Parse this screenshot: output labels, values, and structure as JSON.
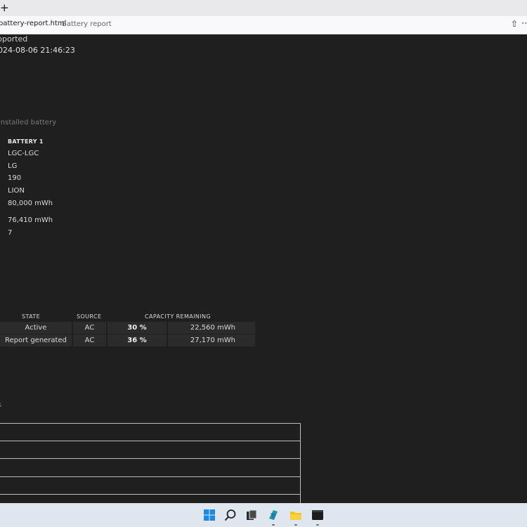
{
  "browser": {
    "new_tab_glyph": "+",
    "url": "battery-report.html",
    "page_name": "Battery report",
    "share_glyph": "⇧",
    "menu_glyph": "⋯"
  },
  "report_header": {
    "line1": "pported",
    "line2": "024-08-06  21:46:23"
  },
  "installed_batteries": {
    "caption": "installed battery",
    "battery_label": "BATTERY 1",
    "values": [
      "LGC-LGC",
      "LG",
      "190",
      "LION",
      "80,000 mWh",
      "76,410 mWh",
      "7"
    ]
  },
  "recent_usage": {
    "headers": {
      "state": "STATE",
      "source": "SOURCE",
      "capacity": "CAPACITY REMAINING"
    },
    "rows": [
      {
        "state": "Active",
        "source": "AC",
        "percent": "30 %",
        "mwh": "22,560 mWh"
      },
      {
        "state": "Report generated",
        "source": "AC",
        "percent": "36 %",
        "mwh": "27,170 mWh"
      }
    ]
  },
  "capacity_history": {
    "caption": "s"
  },
  "taskbar": {
    "icons": [
      "windows-start-icon",
      "search-icon",
      "task-view-icon",
      "copilot-icon",
      "file-explorer-icon",
      "terminal-icon"
    ],
    "colors": {
      "background": "#dfe6f0",
      "start_blue": "#1b8be0",
      "explorer_yellow": "#f5c518"
    }
  }
}
